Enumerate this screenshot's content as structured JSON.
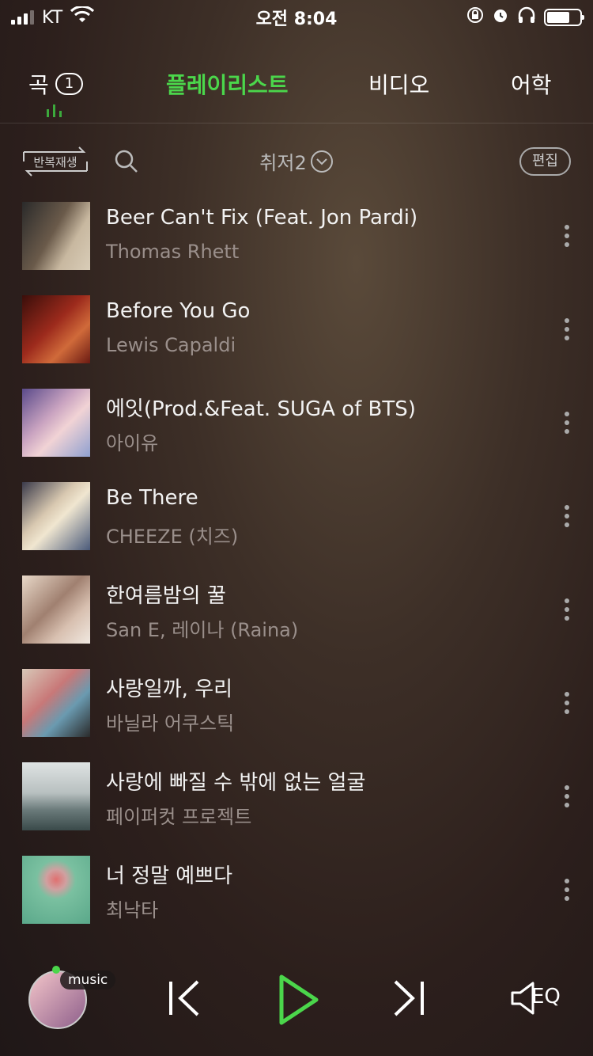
{
  "statusbar": {
    "carrier": "KT",
    "time": "오전 8:04"
  },
  "tabs": {
    "song": "곡",
    "song_count": "1",
    "playlist": "플레이리스트",
    "video": "비디오",
    "study": "어학"
  },
  "toolbar": {
    "repeat": "반복재생",
    "sort": "취저2",
    "edit": "편집"
  },
  "songs": [
    {
      "title": "Beer Can't Fix (Feat. Jon Pardi)",
      "artist": "Thomas Rhett"
    },
    {
      "title": "Before You Go",
      "artist": "Lewis Capaldi"
    },
    {
      "title": "에잇(Prod.&Feat. SUGA of BTS)",
      "artist": "아이유"
    },
    {
      "title": "Be There",
      "artist": "CHEEZE (치즈)"
    },
    {
      "title": "한여름밤의 꿀",
      "artist": "San E, 레이나 (Raina)"
    },
    {
      "title": "사랑일까, 우리",
      "artist": "바닐라 어쿠스틱"
    },
    {
      "title": "사랑에 빠질 수 밖에 없는 얼굴",
      "artist": "페이퍼컷 프로젝트"
    },
    {
      "title": "너 정말 예쁘다",
      "artist": "최낙타"
    }
  ],
  "player": {
    "source_badge": "music",
    "eq_label": "EQ"
  },
  "colors": {
    "accent": "#4bd64b"
  }
}
